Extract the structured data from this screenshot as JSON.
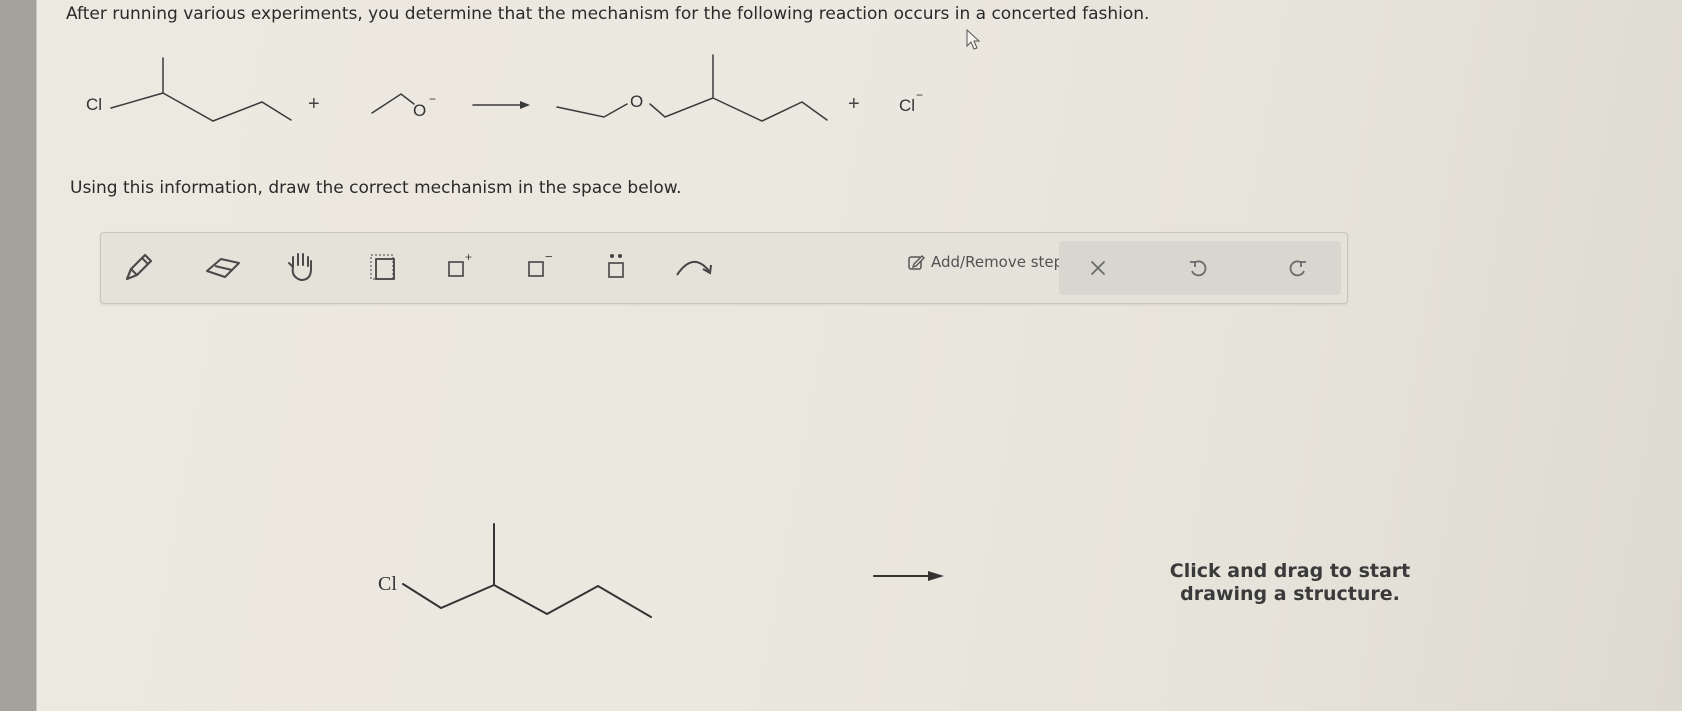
{
  "question": {
    "text": "After running various experiments, you determine that the mechanism for the following reaction occurs in a concerted fashion."
  },
  "reaction": {
    "reactant1_atom": "Cl",
    "plus1": "+",
    "reactant2_atom": "O",
    "reactant2_charge": "−",
    "product1_atom": "O",
    "plus2": "+",
    "product2_atom": "Cl",
    "product2_charge": "−"
  },
  "instruction": {
    "text": "Using this information, draw the correct mechanism in the space below."
  },
  "toolbar": {
    "tools": [
      {
        "name": "pencil-tool",
        "icon": "pencil-icon"
      },
      {
        "name": "eraser-tool",
        "icon": "eraser-icon"
      },
      {
        "name": "move-tool",
        "icon": "hand-icon"
      },
      {
        "name": "select-tool",
        "icon": "selection-box-icon"
      },
      {
        "name": "add-positive-charge-tool",
        "icon": "positive-charge-icon",
        "sup": "+"
      },
      {
        "name": "add-negative-charge-tool",
        "icon": "negative-charge-icon",
        "sup": "−"
      },
      {
        "name": "lone-pair-tool",
        "icon": "lone-pair-icon"
      },
      {
        "name": "curved-arrow-tool",
        "icon": "curved-arrow-icon"
      }
    ],
    "step_label": "Add/Remove step",
    "actions": {
      "clear": "clear-icon",
      "undo": "undo-icon",
      "redo": "redo-icon"
    }
  },
  "canvas": {
    "starting_atom": "Cl",
    "hint": "Click and drag to start drawing a structure."
  },
  "colors": {
    "ink": "#333333",
    "toolbar_bg": "#e5e2d9",
    "action_bg": "#d8d6cf",
    "page_bg": "#ebe8df"
  }
}
